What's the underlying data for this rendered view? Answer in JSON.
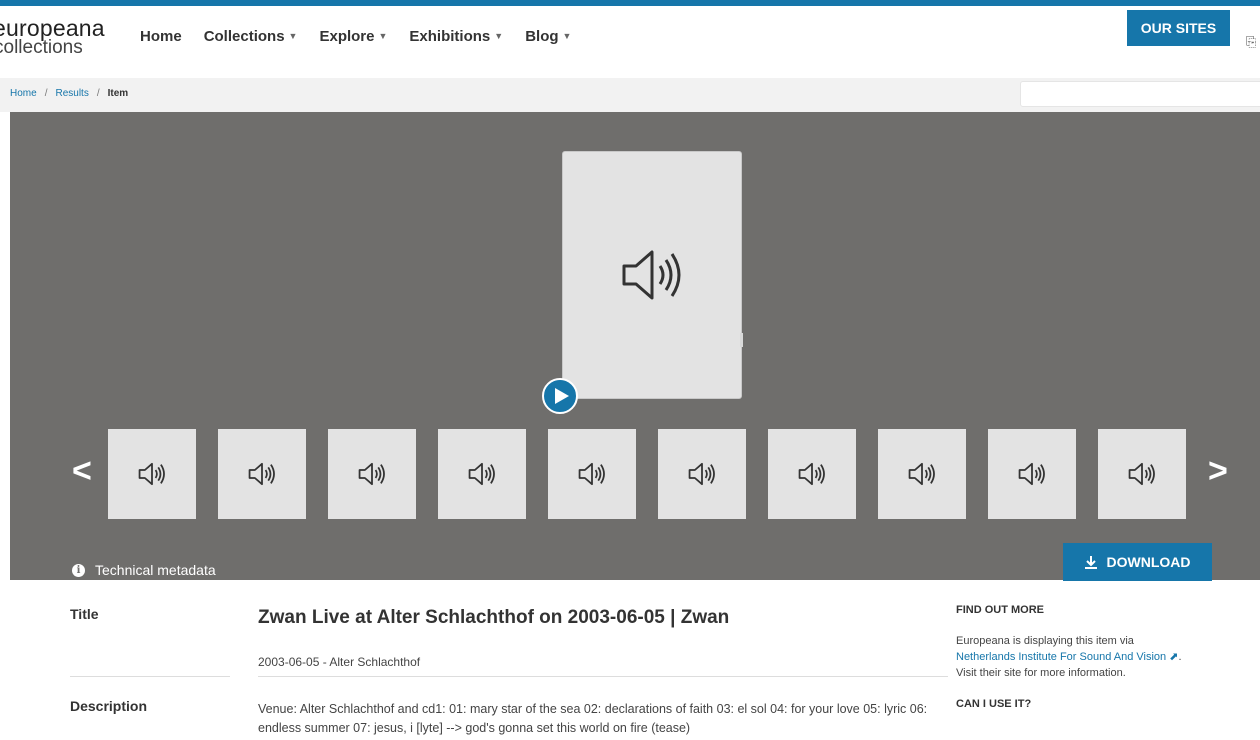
{
  "header": {
    "logo_line1": "europeana",
    "logo_line2": "collections",
    "nav": [
      {
        "label": "Home",
        "has_caret": false
      },
      {
        "label": "Collections",
        "has_caret": true
      },
      {
        "label": "Explore",
        "has_caret": true
      },
      {
        "label": "Exhibitions",
        "has_caret": true
      },
      {
        "label": "Blog",
        "has_caret": true
      }
    ],
    "our_sites": "OUR SITES"
  },
  "breadcrumb": {
    "home": "Home",
    "results": "Results",
    "current": "Item",
    "separator": "/"
  },
  "viewer": {
    "media_icon": "speaker-icon",
    "prev_arrow": "<",
    "next_arrow": ">",
    "thumbnail_count": 10,
    "technical_metadata": "Technical metadata",
    "download": "DOWNLOAD"
  },
  "item": {
    "title_label": "Title",
    "title": "Zwan Live at Alter Schlachthof on 2003-06-05 | Zwan",
    "subtitle": "2003-06-05 - Alter Schlachthof",
    "description_label": "Description",
    "description": "Venue: Alter Schlachthof and cd1: 01: mary star of the sea 02: declarations of faith 03: el sol 04: for your love 05: lyric 06: endless summer 07: jesus, i [lyte] --> god's gonna set this world on fire (tease)"
  },
  "sidebar": {
    "find_out_more": "FIND OUT MORE",
    "text_before": "Europeana is displaying this item via",
    "provider_link": "Netherlands Institute For Sound And Vision",
    "text_after": "Visit their site for more information.",
    "can_i_use": "CAN I USE IT?"
  },
  "colors": {
    "accent": "#1676aa",
    "viewer_bg": "#6f6e6c",
    "thumb_bg": "#e3e3e3"
  }
}
